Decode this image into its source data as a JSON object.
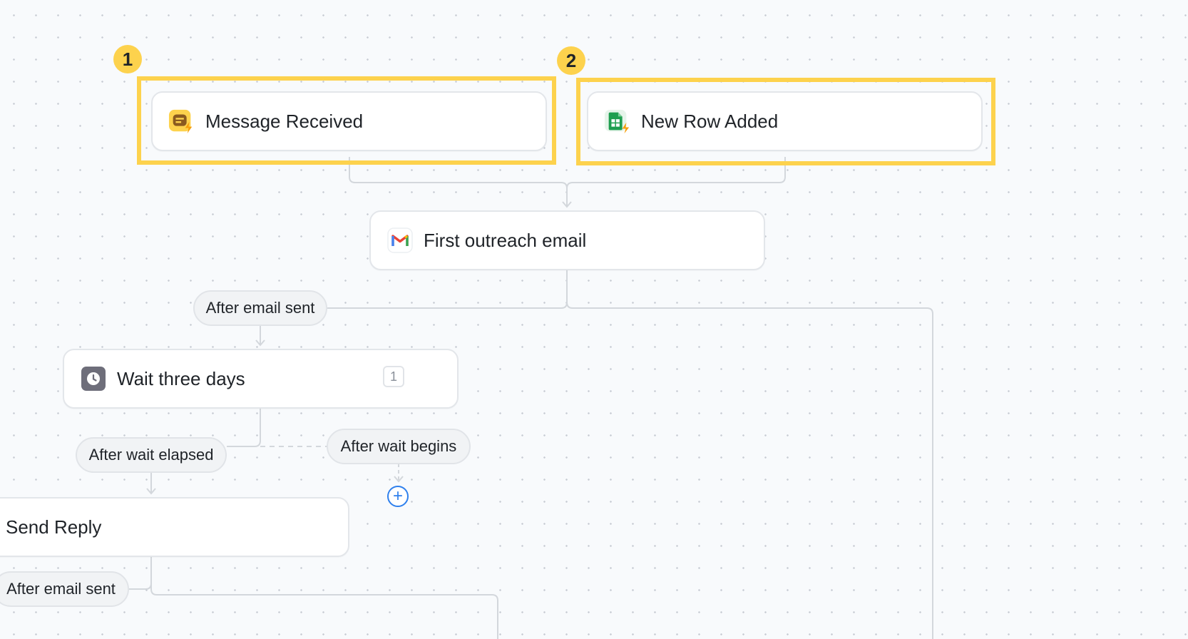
{
  "colors": {
    "highlight": "#fdd24d",
    "connector": "#d3d7dc",
    "add_button": "#2f80ed",
    "canvas_bg": "#f8fafc"
  },
  "callouts": [
    {
      "number": "1"
    },
    {
      "number": "2"
    }
  ],
  "nodes": {
    "message_received": {
      "label": "Message Received",
      "icon": "chat-trigger-icon"
    },
    "new_row_added": {
      "label": "New Row Added",
      "icon": "google-sheets-trigger-icon"
    },
    "first_outreach": {
      "label": "First outreach email",
      "icon": "gmail-icon"
    },
    "wait_three_days": {
      "label": "Wait three days",
      "icon": "clock-icon",
      "count": "1"
    },
    "send_reply": {
      "label": "Send Reply"
    }
  },
  "branches": {
    "after_email_sent_1": "After email sent",
    "after_wait_elapsed": "After wait elapsed",
    "after_wait_begins": "After wait begins",
    "after_email_sent_2": "After email sent"
  },
  "add_step": {
    "symbol": "+",
    "icon": "plus-circle-icon"
  }
}
